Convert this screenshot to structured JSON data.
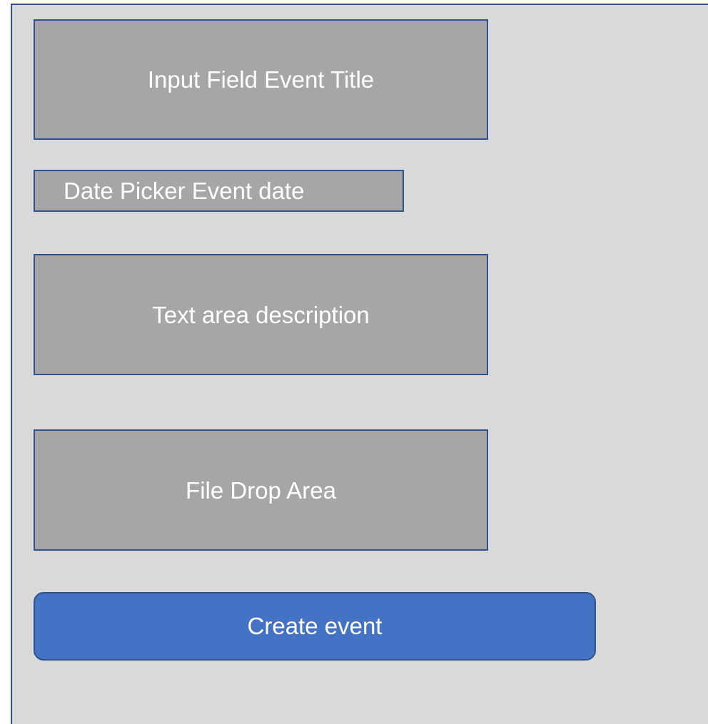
{
  "form": {
    "title_input_label": "Input Field Event Title",
    "date_picker_label": "Date Picker Event date",
    "description_label": "Text area description",
    "file_drop_label": "File Drop Area",
    "create_button_label": "Create event"
  },
  "colors": {
    "panel_background": "#d9d9d9",
    "field_background": "#a6a6a6",
    "border": "#2f528f",
    "button_background": "#4472c4",
    "text": "#ffffff"
  }
}
